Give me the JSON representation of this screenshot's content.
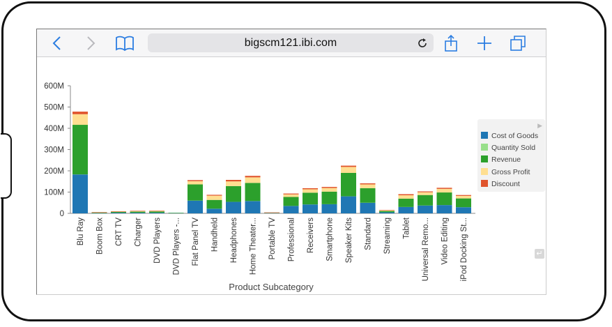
{
  "browser": {
    "url": "bigscm121.ibi.com",
    "icons": [
      "back-icon",
      "forward-icon",
      "bookmarks-icon",
      "reload-icon",
      "share-icon",
      "add-tab-icon",
      "tabs-icon"
    ]
  },
  "colors": {
    "cost_of_goods": "#1f77b4",
    "quantity_sold": "#98df8a",
    "revenue": "#2ca02c",
    "gross_profit": "#ffdf91",
    "discount": "#e0542c"
  },
  "chart_data": {
    "type": "bar",
    "stacked": true,
    "xlabel": "Product Subcategory",
    "ylabel": "",
    "ylim": [
      0,
      600
    ],
    "y_unit": "M",
    "y_ticks": [
      "0",
      "100M",
      "200M",
      "300M",
      "400M",
      "500M",
      "600M"
    ],
    "grid": false,
    "legend_position": "right",
    "categories": [
      "Blu Ray",
      "Boom Box",
      "CRT TV",
      "Charger",
      "DVD Players",
      "DVD Players -...",
      "Flat Panel TV",
      "Handheld",
      "Headphones",
      "Home Theater...",
      "Portable TV",
      "Professional",
      "Receivers",
      "Smartphone",
      "Speaker Kits",
      "Standard",
      "Streaming",
      "Tablet",
      "Universal Remo...",
      "Video Editing",
      "iPod Docking St..."
    ],
    "series": [
      {
        "name": "Cost of Goods",
        "values": [
          183,
          1,
          3,
          3,
          3,
          0.5,
          60,
          22,
          54,
          58,
          1,
          35,
          42,
          43,
          80,
          50,
          5,
          30,
          37,
          39,
          29
        ]
      },
      {
        "name": "Quantity Sold",
        "values": [
          0.3,
          0,
          0,
          0,
          0,
          0,
          0.3,
          0.2,
          0.3,
          0.3,
          0,
          0.2,
          0.2,
          0.2,
          0.3,
          0.2,
          0.1,
          0.2,
          0.2,
          0.2,
          0.2
        ]
      },
      {
        "name": "Revenue",
        "values": [
          233,
          2,
          4,
          5,
          6,
          0.5,
          76,
          41,
          74,
          85,
          1,
          42,
          55,
          59,
          110,
          68,
          6,
          39,
          49,
          59,
          41
        ]
      },
      {
        "name": "Gross Profit",
        "values": [
          50,
          1,
          1,
          2,
          2,
          0,
          15,
          20,
          22,
          26,
          0.5,
          12,
          16,
          17,
          28,
          18,
          3,
          16,
          13,
          17,
          12
        ]
      },
      {
        "name": "Discount",
        "values": [
          12,
          0.5,
          0.5,
          1,
          1,
          0,
          5,
          4,
          7,
          7,
          0.2,
          4,
          5,
          5,
          6,
          5,
          1,
          5,
          4,
          5,
          4
        ]
      }
    ]
  }
}
